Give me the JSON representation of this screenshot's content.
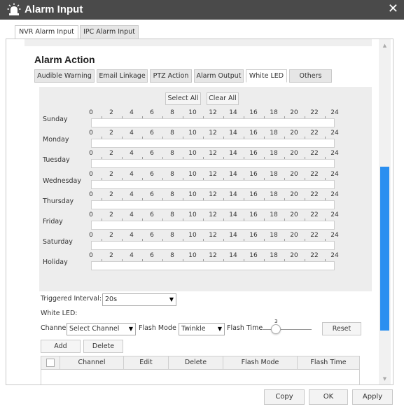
{
  "window": {
    "title": "Alarm Input",
    "icon": "alarm-siren-icon",
    "close_icon": "close-icon",
    "title_bar_color": "#4a4a4a"
  },
  "outer_tabs": [
    {
      "label": "NVR Alarm Input",
      "active": true
    },
    {
      "label": "IPC Alarm Input",
      "active": false
    }
  ],
  "section": {
    "title": "Alarm Action"
  },
  "inner_tabs": [
    {
      "label": "Audible Warning",
      "active": false
    },
    {
      "label": "Email Linkage",
      "active": false
    },
    {
      "label": "PTZ Action",
      "active": false
    },
    {
      "label": "Alarm Output",
      "active": false
    },
    {
      "label": "White LED",
      "active": true
    },
    {
      "label": "Others",
      "active": false
    }
  ],
  "schedule": {
    "select_all": "Select All",
    "clear_all": "Clear All",
    "axis": [
      "0",
      "2",
      "4",
      "6",
      "8",
      "10",
      "12",
      "14",
      "16",
      "18",
      "20",
      "22",
      "24"
    ],
    "days": [
      "Sunday",
      "Monday",
      "Tuesday",
      "Wednesday",
      "Thursday",
      "Friday",
      "Saturday",
      "Holiday"
    ]
  },
  "triggered_interval": {
    "label": "Triggered Interval:",
    "value": "20s"
  },
  "white_led": {
    "label": "White LED:",
    "channel_label": "Channel",
    "channel_value": "Select Channel",
    "flash_mode_label": "Flash Mode",
    "flash_mode_value": "Twinkle",
    "flash_time_label": "Flash Time",
    "flash_time_value": "3",
    "reset_label": "Reset"
  },
  "actions": {
    "add": "Add",
    "delete": "Delete"
  },
  "table": {
    "columns": [
      "Channel",
      "Edit",
      "Delete",
      "Flash Mode",
      "Flash Time"
    ]
  },
  "footer": {
    "copy": "Copy",
    "ok": "OK",
    "apply": "Apply"
  },
  "colors": {
    "scrollbar_thumb": "#2b8ff0",
    "schedule_background": "#ededed"
  }
}
